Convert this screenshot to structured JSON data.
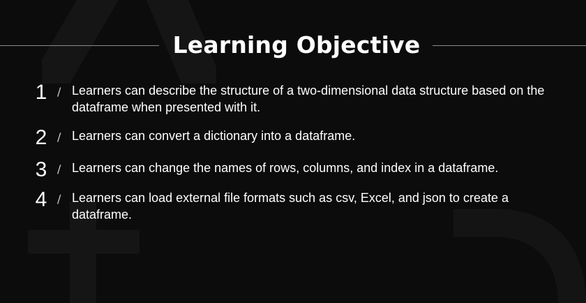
{
  "slide": {
    "title": "Learning Objective"
  },
  "objectives": [
    {
      "number": "1",
      "text": "Learners can describe the structure of a two-dimensional data structure based on the dataframe when presented with it."
    },
    {
      "number": "2",
      "text": "Learners can convert a dictionary into a dataframe."
    },
    {
      "number": "3",
      "text": "Learners can change the names of rows, columns, and index in a dataframe."
    },
    {
      "number": "4",
      "text": "Learners can load external file formats such as csv, Excel, and json to create a dataframe."
    }
  ],
  "separator_glyph": "/",
  "colors": {
    "background": "#0c0c0c",
    "text": "#ffffff",
    "rule": "#8a8a8a",
    "decor": "#161616"
  }
}
